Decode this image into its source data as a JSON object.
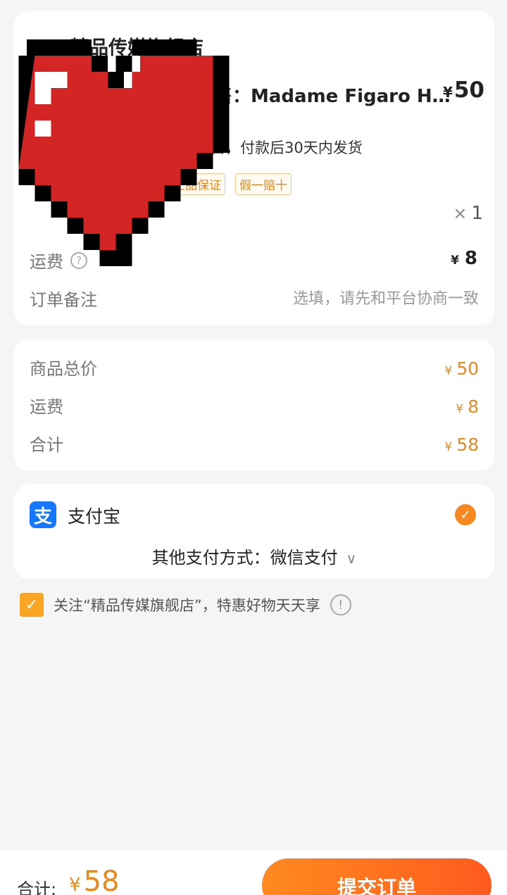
{
  "order": {
    "shop_name": "精品传媒旗舰店",
    "product_title": "预售：Madame Figaro H…",
    "product_price": "50",
    "currency": "¥",
    "presale_note": "预售，付款后30天内发货",
    "tags": [
      "正品保证",
      "假一赔十"
    ],
    "qty_symbol": "×",
    "qty": "1",
    "shipping_label": "运费",
    "help_icon": "?",
    "shipping_fee": "8",
    "remark_label": "订单备注",
    "remark_placeholder": "选填，请先和平台协商一致"
  },
  "summary": {
    "rows": [
      {
        "label": "商品总价",
        "value": "50"
      },
      {
        "label": "运费",
        "value": "8"
      },
      {
        "label": "合计",
        "value": "58"
      }
    ]
  },
  "payment": {
    "alipay_icon": "支",
    "alipay_label": "支付宝",
    "check": "✓",
    "other_label": "其他支付方式：微信支付",
    "chevron": "∨"
  },
  "follow": {
    "check": "✓",
    "text": "关注“精品传媒旗舰店”，特惠好物天天享",
    "info": "!"
  },
  "bottom": {
    "total_label": "合计:",
    "total_value": "58",
    "submit_label": "提交订单"
  },
  "colors": {
    "accent": "#e8891d",
    "button_start": "#ff8a1f",
    "button_end": "#ff5a1f",
    "alipay_blue": "#1677ff",
    "heart_red": "#d42525"
  }
}
